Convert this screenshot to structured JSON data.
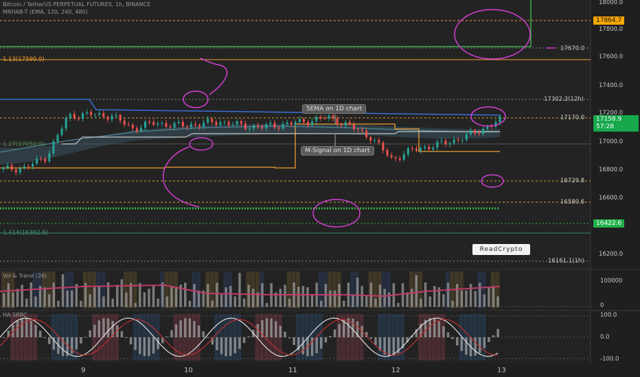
{
  "header": {
    "symbol_line": "Bitcoin / TetherUS PERPETUAL FUTURES, 1h, BINANCE",
    "indicator_line": "MRHAB-T (EMA, 120, 240, 480)",
    "vol_title": "Vol & Trend (26)",
    "ha_title": "HA SRRC"
  },
  "price_axis": {
    "ticks": [
      "18000.0",
      "17800.0",
      "17600.0",
      "17400.0",
      "17200.0",
      "17000.0",
      "16800.0",
      "16600.0",
      "16400.0",
      "16200.0"
    ],
    "current_price": "17158.9",
    "countdown": "57:28",
    "level_high": "17864.7",
    "level_low": "16422.6"
  },
  "level_labels": {
    "l17670": "17670.0",
    "l17302": "17302.2(12h)",
    "l17170": "17170.0",
    "l16729": "16729.8",
    "l16580": "16580.6",
    "l16161": "16161.1(1h)",
    "fib113": "1.13(17590.0)",
    "fib127": "1.27(17050.0)",
    "fib1414": "1.414(16362.6)"
  },
  "annotations": {
    "sema": "5EMA on 1D chart",
    "msignal": "M-Signal on 1D chart"
  },
  "vol_axis": [
    "100000",
    "0"
  ],
  "ha_axis": [
    "100.0",
    "0.0",
    "-100.0"
  ],
  "time_axis": [
    "9",
    "10",
    "11",
    "12",
    "13"
  ],
  "logo_text": "ReadCrypto",
  "colors": {
    "bg": "#1f1f1f",
    "up": "#26a69a",
    "down": "#ef5350",
    "orange": "#f0a030",
    "magenta": "#d63fd6",
    "green_line": "#3bb34a",
    "blue_line": "#3a6fd8",
    "badge_orange": "#f7a600",
    "badge_green": "#22b14c"
  },
  "chart_data": {
    "type": "line",
    "title": "",
    "xlabel": "",
    "ylabel": "",
    "x": [
      "9",
      "10",
      "11",
      "12",
      "13"
    ],
    "ylim": [
      16150,
      18050
    ],
    "series": [
      {
        "name": "",
        "values": [
          16810,
          16820,
          16900,
          17190,
          17200,
          17190,
          17100,
          17140,
          17120,
          17130,
          17150,
          17120,
          17110,
          17130,
          17150,
          17180,
          17120,
          17040,
          16880,
          16950,
          16980,
          17020,
          17080,
          17158.9
        ]
      }
    ]
  }
}
